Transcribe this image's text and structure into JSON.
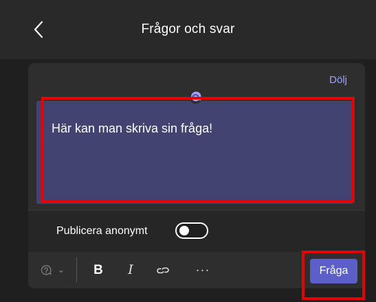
{
  "header": {
    "title": "Frågor och svar",
    "back_icon": "chevron-left-icon"
  },
  "card": {
    "hide_label": "Dölj",
    "qa_icon": "qa-bubble-icon",
    "question_text": "Här kan man skriva sin fråga!",
    "anonymous_label": "Publicera anonymt",
    "anonymous_enabled": false
  },
  "toolbar": {
    "qa_icon": "qa-bubble-icon",
    "chevron": "⌄",
    "bold": "B",
    "italic": "I",
    "link_icon": "link-icon",
    "more": "···",
    "send_label": "Fråga"
  },
  "colors": {
    "header_bg": "#292929",
    "page_bg": "#1f1f1f",
    "card_bg": "#2e2e2e",
    "question_bg": "#434372",
    "accent": "#5b5fc7",
    "link": "#9ea2ff",
    "highlight": "#e60000"
  }
}
